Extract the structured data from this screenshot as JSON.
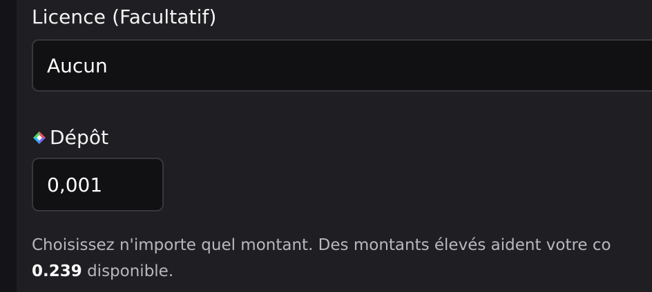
{
  "licence": {
    "label": "Licence (Facultatif)",
    "selected_value": "Aucun"
  },
  "deposit": {
    "label": "Dépôt",
    "icon": "token-logo-icon",
    "value": "0,001"
  },
  "help": {
    "text": "Choisissez n'importe quel montant. Des montants élevés aident votre co",
    "available_amount": "0.239",
    "available_suffix": " disponible."
  }
}
